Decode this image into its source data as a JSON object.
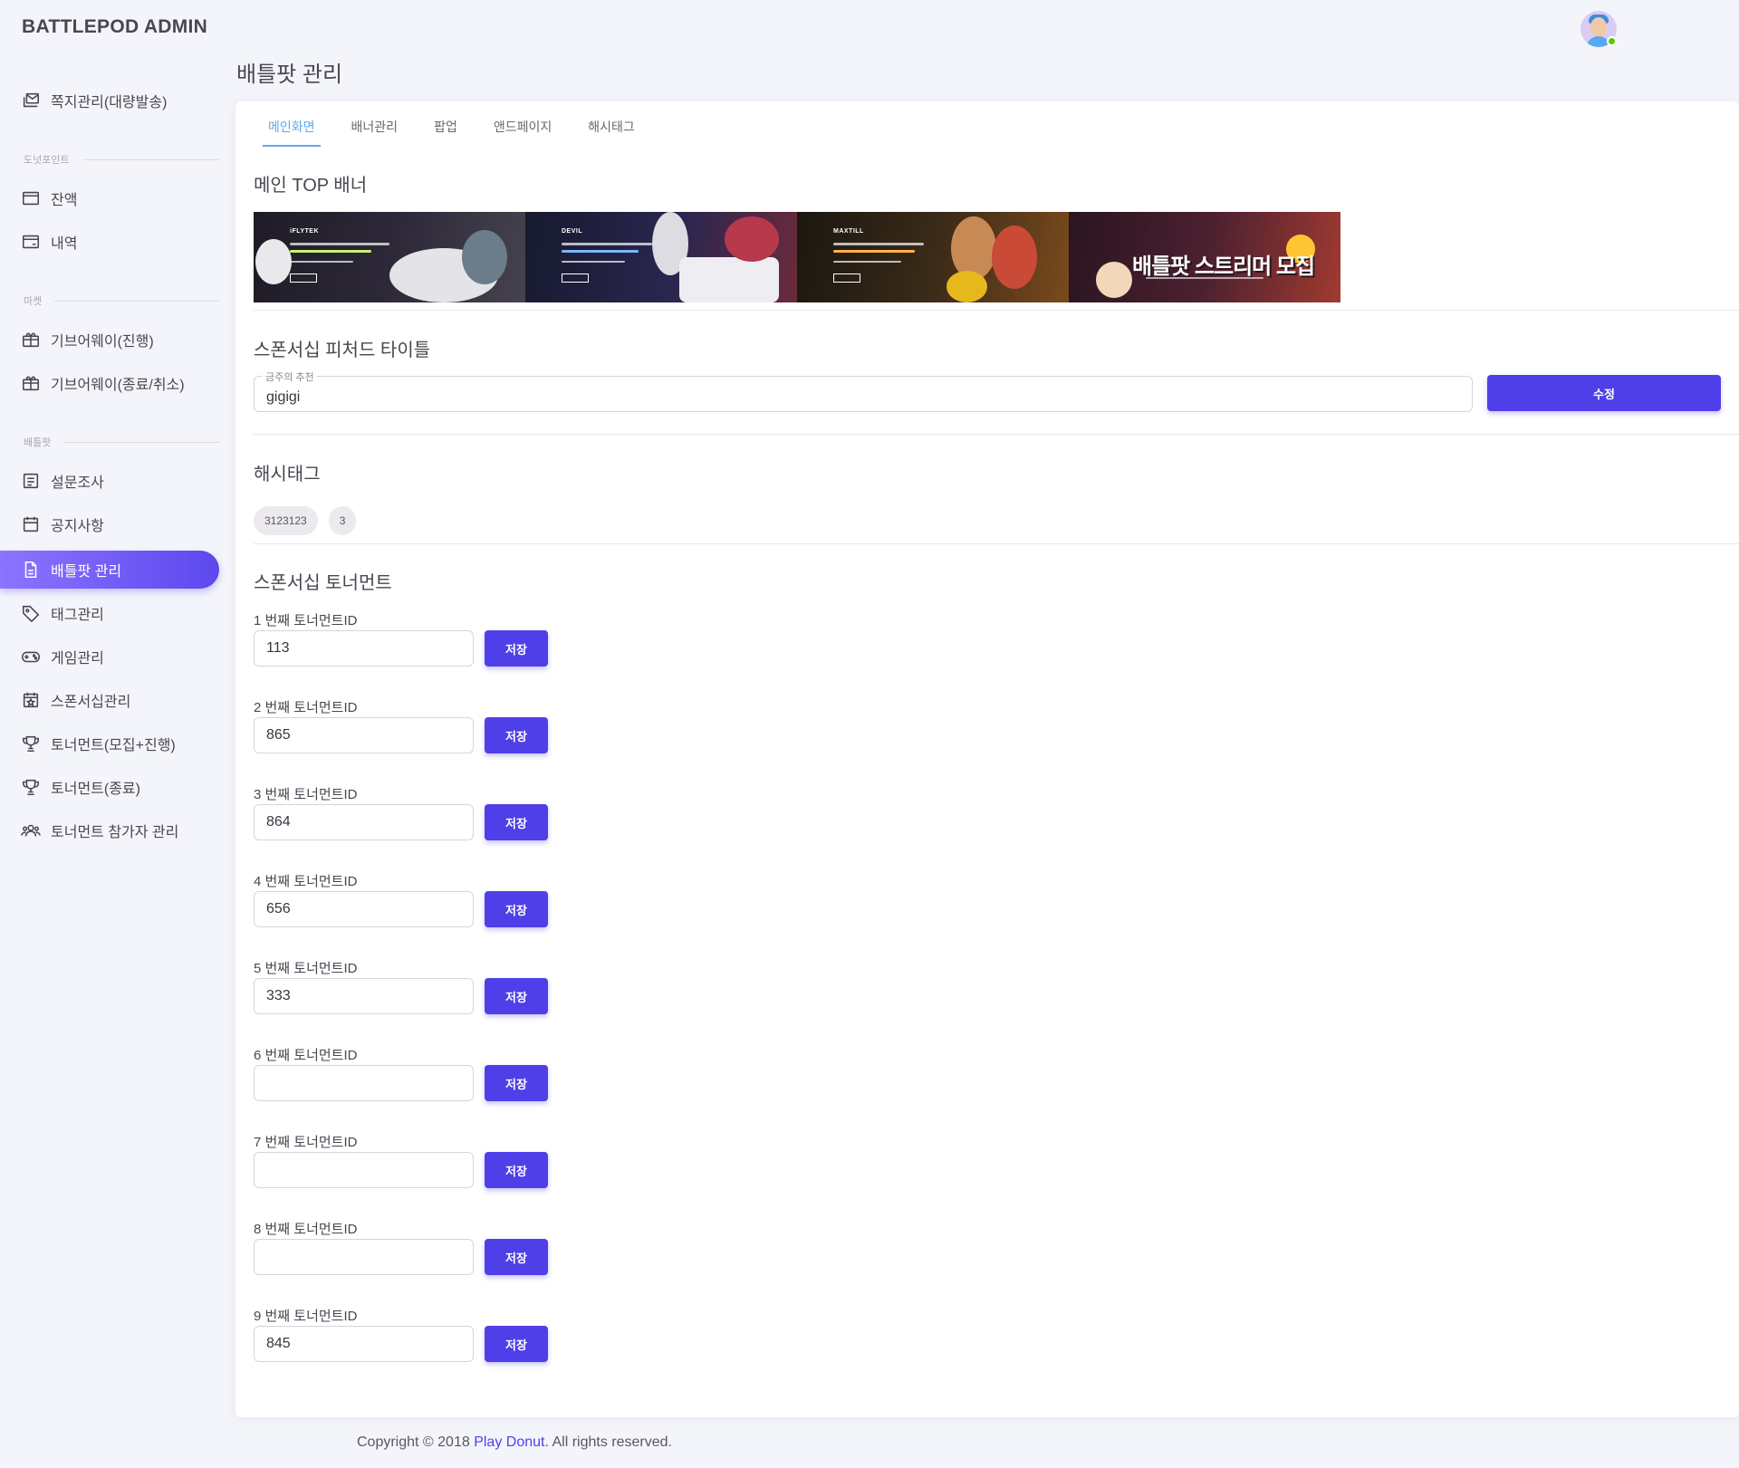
{
  "app": {
    "title": "BATTLEPOD ADMIN"
  },
  "sidebar": {
    "items": [
      {
        "label": "쪽지관리(대량발송)",
        "icon": "mail-stack-icon"
      },
      {
        "label": "잔액",
        "icon": "wallet-icon"
      },
      {
        "label": "내역",
        "icon": "receipt-icon"
      },
      {
        "label": "기브어웨이(진행)",
        "icon": "gift-icon"
      },
      {
        "label": "기브어웨이(종료/취소)",
        "icon": "gift-icon"
      },
      {
        "label": "설문조사",
        "icon": "survey-icon"
      },
      {
        "label": "공지사항",
        "icon": "calendar-icon"
      },
      {
        "label": "배틀팟 관리",
        "icon": "document-icon",
        "active": true
      },
      {
        "label": "태그관리",
        "icon": "tag-icon"
      },
      {
        "label": "게임관리",
        "icon": "gamepad-icon"
      },
      {
        "label": "스폰서십관리",
        "icon": "calendar-star-icon"
      },
      {
        "label": "토너먼트(모집+진행)",
        "icon": "trophy-icon"
      },
      {
        "label": "토너먼트(종료)",
        "icon": "trophy-icon"
      },
      {
        "label": "토너먼트 참가자 관리",
        "icon": "group-icon"
      }
    ],
    "sections": {
      "donut_point": "도넛포인트",
      "market": "마켓",
      "battlepod": "배틀팟"
    }
  },
  "page": {
    "title": "배틀팟 관리"
  },
  "tabs": [
    {
      "label": "메인화면",
      "active": true
    },
    {
      "label": "배너관리"
    },
    {
      "label": "팝업"
    },
    {
      "label": "앤드페이지"
    },
    {
      "label": "해시태그"
    }
  ],
  "banner_section": {
    "title": "메인 TOP 배너",
    "banners": [
      {
        "brand": "iFLYTEK"
      },
      {
        "brand": "DEVIL"
      },
      {
        "brand": "MAXTILL"
      },
      {
        "headline": "배틀팟 스트리머 모집"
      }
    ]
  },
  "featured_title": {
    "title": "스폰서십 피처드 타이틀",
    "field_label": "금주의 추천",
    "value": "gigigi",
    "edit_label": "수정"
  },
  "hashtags": {
    "title": "해시태그",
    "chips": [
      "3123123",
      "3"
    ]
  },
  "tournaments": {
    "title": "스폰서십 토너먼트",
    "save_label": "저장",
    "rows": [
      {
        "label": "1 번째 토너먼트ID",
        "value": "113"
      },
      {
        "label": "2 번째 토너먼트ID",
        "value": "865"
      },
      {
        "label": "3 번째 토너먼트ID",
        "value": "864"
      },
      {
        "label": "4 번째 토너먼트ID",
        "value": "656"
      },
      {
        "label": "5 번째 토너먼트ID",
        "value": "333"
      },
      {
        "label": "6 번째 토너먼트ID",
        "value": ""
      },
      {
        "label": "7 번째 토너먼트ID",
        "value": ""
      },
      {
        "label": "8 번째 토너먼트ID",
        "value": ""
      },
      {
        "label": "9 번째 토너먼트ID",
        "value": "845"
      }
    ]
  },
  "footer": {
    "prefix": "Copyright © 2018 ",
    "link": "Play Donut",
    "suffix": ". All rights reserved."
  },
  "colors": {
    "primary": "#4f3fe8",
    "tab_active": "#5ea8f0",
    "background": "#f4f5fa"
  }
}
